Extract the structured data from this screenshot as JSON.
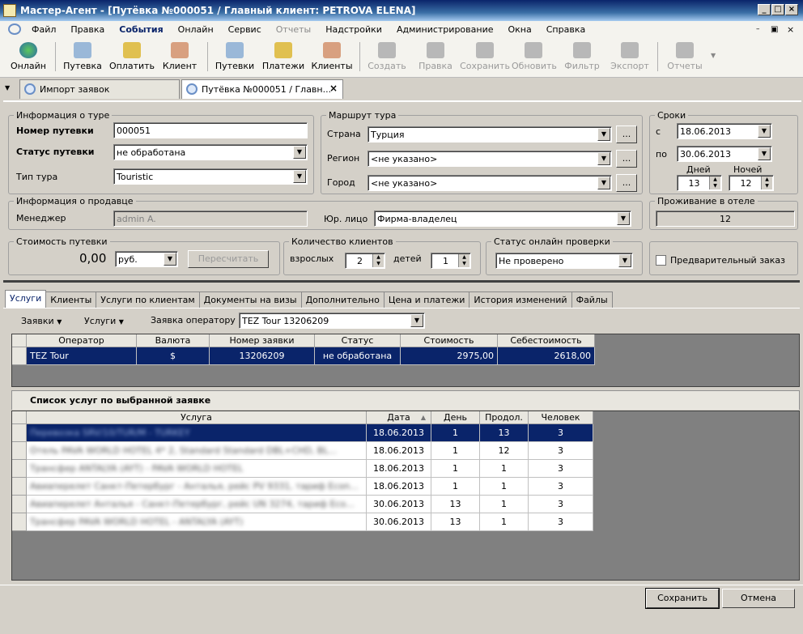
{
  "window": {
    "title": "Мастер-Агент - [Путёвка №000051 / Главный клиент: PETROVA ELENA]"
  },
  "menu": [
    "Файл",
    "Правка",
    "События",
    "Онлайн",
    "Сервис",
    "Отчеты",
    "Надстройки",
    "Администрирование",
    "Окна",
    "Справка"
  ],
  "toolbar": {
    "online": "Онлайн",
    "tour": "Путевка",
    "pay": "Оплатить",
    "client": "Клиент",
    "tours": "Путевки",
    "payments": "Платежи",
    "clients": "Клиенты",
    "create": "Создать",
    "edit": "Правка",
    "save": "Сохранить",
    "refresh": "Обновить",
    "filter": "Фильтр",
    "export": "Экспорт",
    "reports": "Отчеты"
  },
  "doc_tabs": {
    "import": "Импорт заявок",
    "tour": "Путёвка №000051 / Главн..."
  },
  "tour_info": {
    "legend": "Информация о туре",
    "number_label": "Номер путевки",
    "number": "000051",
    "status_label": "Статус путевки",
    "status": "не обработана",
    "type_label": "Тип тура",
    "type": "Touristic"
  },
  "route": {
    "legend": "Маршрут тура",
    "country_label": "Страна",
    "country": "Турция",
    "region_label": "Регион",
    "region": "<не указано>",
    "city_label": "Город",
    "city": "<не указано>",
    "more": "..."
  },
  "dates": {
    "legend": "Сроки",
    "from_label": "с",
    "from": "18.06.2013",
    "to_label": "по",
    "to": "30.06.2013",
    "days_label": "Дней",
    "days": "13",
    "nights_label": "Ночей",
    "nights": "12"
  },
  "seller": {
    "legend": "Информация о продавце",
    "manager_label": "Менеджер",
    "manager": "admin A.",
    "entity_label": "Юр. лицо",
    "entity": "Фирма-владелец"
  },
  "hotel": {
    "legend": "Проживание в отеле",
    "value": "12"
  },
  "cost": {
    "legend": "Стоимость путевки",
    "value": "0,00",
    "currency": "руб.",
    "recalc": "Пересчитать"
  },
  "clients_count": {
    "legend": "Количество клиентов",
    "adults_label": "взрослых",
    "adults": "2",
    "children_label": "детей",
    "children": "1"
  },
  "online_status": {
    "legend": "Статус онлайн проверки",
    "value": "Не проверено"
  },
  "preorder": {
    "label": "Предварительный заказ"
  },
  "svc_tabs": [
    "Услуги",
    "Клиенты",
    "Услуги по клиентам",
    "Документы на визы",
    "Дополнительно",
    "Цена и платежи",
    "История изменений",
    "Файлы"
  ],
  "subbar": {
    "orders": "Заявки",
    "services": "Услуги",
    "operator_order_label": "Заявка оператору",
    "operator_order": "TEZ Tour 13206209"
  },
  "orders_grid": {
    "headers": [
      "Оператор",
      "Валюта",
      "Номер заявки",
      "Статус",
      "Стоимость",
      "Себестоимость"
    ],
    "rows": [
      [
        "TEZ Tour",
        "$",
        "13206209",
        "не обработана",
        "2975,00",
        "2618,00"
      ]
    ]
  },
  "services_list": {
    "title": "Список услуг по выбранной заявке",
    "headers": [
      "Услуга",
      "Дата",
      "День",
      "Продол.",
      "Человек"
    ],
    "rows": [
      [
        "Перевозка SRV/10/TUR/M - TURKEY",
        "18.06.2013",
        "1",
        "13",
        "3"
      ],
      [
        "Отель PAVA WORLD HOTEL 4* 2, Standard Standard DBL+CHD, BL...",
        "18.06.2013",
        "1",
        "12",
        "3"
      ],
      [
        "Трансфер ANTALYA (AYT) - PAVA WORLD HOTEL",
        "18.06.2013",
        "1",
        "1",
        "3"
      ],
      [
        "Авиаперелет Санкт-Петербург - Анталья, рейс PV 9331, тариф Econ...",
        "18.06.2013",
        "1",
        "1",
        "3"
      ],
      [
        "Авиаперелет Анталья - Санкт-Петербург, рейс UN 3274, тариф Eco...",
        "30.06.2013",
        "13",
        "1",
        "3"
      ],
      [
        "Трансфер PAVA WORLD HOTEL - ANTALYA (AYT)",
        "30.06.2013",
        "13",
        "1",
        "3"
      ]
    ]
  },
  "footer": {
    "save": "Сохранить",
    "cancel": "Отмена"
  }
}
